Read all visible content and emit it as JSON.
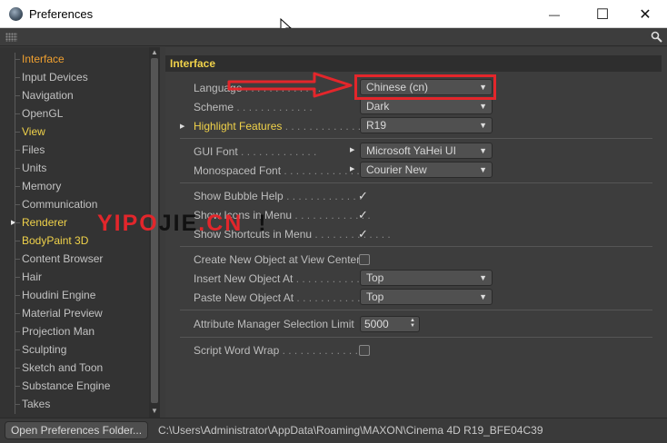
{
  "window": {
    "title": "Preferences",
    "minimize_glyph": "—",
    "maximize_glyph": "☐",
    "close_glyph": "✕"
  },
  "sidebar": {
    "items": [
      {
        "label": "Interface",
        "state": "selected"
      },
      {
        "label": "Input Devices"
      },
      {
        "label": "Navigation"
      },
      {
        "label": "OpenGL"
      },
      {
        "label": "View",
        "state": "highlight"
      },
      {
        "label": "Files"
      },
      {
        "label": "Units"
      },
      {
        "label": "Memory"
      },
      {
        "label": "Communication"
      },
      {
        "label": "Renderer",
        "state": "highlight",
        "expandable": true
      },
      {
        "label": "BodyPaint 3D",
        "state": "highlight"
      },
      {
        "label": "Content Browser"
      },
      {
        "label": "Hair"
      },
      {
        "label": "Houdini Engine"
      },
      {
        "label": "Material Preview"
      },
      {
        "label": "Projection Man"
      },
      {
        "label": "Sculpting"
      },
      {
        "label": "Sketch and Toon"
      },
      {
        "label": "Substance Engine"
      },
      {
        "label": "Takes"
      }
    ]
  },
  "pane": {
    "header": "Interface",
    "language_label": "Language",
    "language_value": "Chinese (cn)",
    "scheme_label": "Scheme",
    "scheme_value": "Dark",
    "highlight_label": "Highlight Features",
    "highlight_value": "R19",
    "gui_font_label": "GUI Font",
    "gui_font_value": "Microsoft YaHei UI",
    "mono_font_label": "Monospaced Font",
    "mono_font_value": "Courier New",
    "bubble_label": "Show Bubble Help",
    "bubble_checked": true,
    "icons_label": "Show Icons in Menu",
    "icons_checked": true,
    "shortcuts_label": "Show Shortcuts in Menu",
    "shortcuts_checked": true,
    "create_center_label": "Create New Object at View Center",
    "create_center_checked": false,
    "insert_label": "Insert New Object At",
    "insert_value": "Top",
    "paste_label": "Paste New Object At",
    "paste_value": "Top",
    "attr_limit_label": "Attribute Manager Selection Limit",
    "attr_limit_value": "5000",
    "script_wrap_label": "Script Word Wrap",
    "script_wrap_checked": false,
    "dots_long": " . . . . . . . . . . . . .",
    "check_glyph": "✓"
  },
  "watermark": {
    "text_a": "YIPO",
    "text_b": "JIE",
    "text_c": ".CN",
    "text_d": "!"
  },
  "footer": {
    "open_button": "Open Preferences Folder...",
    "path": "C:\\Users\\Administrator\\AppData\\Roaming\\MAXON\\Cinema 4D R19_BFE04C39"
  },
  "colors": {
    "accent_yellow": "#f0d24a",
    "selected_orange": "#f0a030",
    "annotation_red": "#e3262b"
  }
}
